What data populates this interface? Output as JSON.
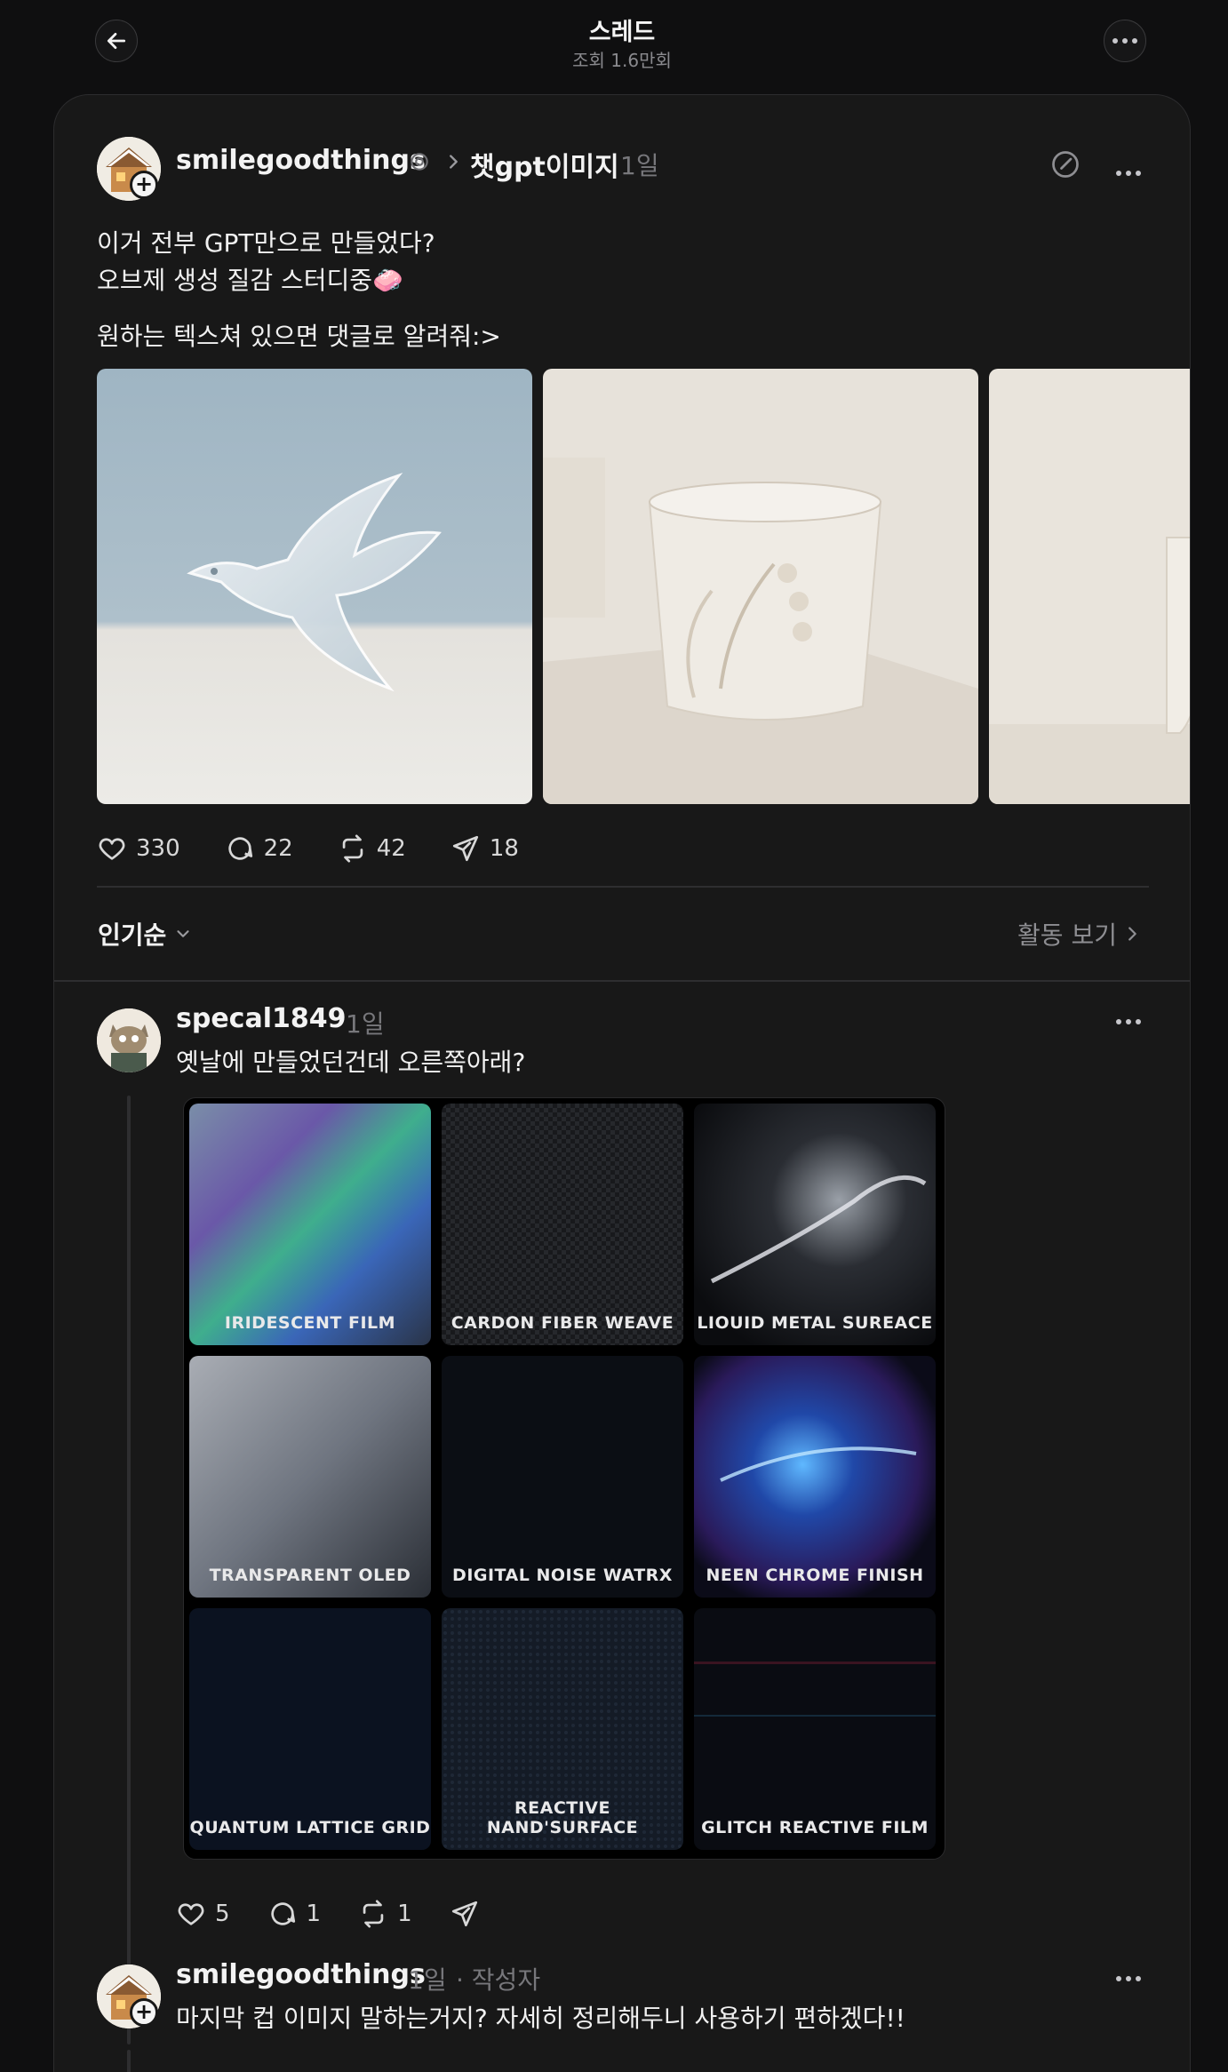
{
  "header": {
    "title": "스레드",
    "subtitle": "조회 1.6만회"
  },
  "post": {
    "username": "smilegoodthings",
    "topic": "챗gpt이미지",
    "time": "1일",
    "lines": [
      "이거 전부 GPT만으로 만들었다?",
      "오브제 생성 질감 스터디중🧼",
      "원하는 텍스쳐 있으면 댓글로 알려줘:>"
    ],
    "images": [
      "glass-bird-image",
      "lily-cup-image",
      "vase-image"
    ],
    "likes": "330",
    "comments": "22",
    "reposts": "42",
    "shares": "18"
  },
  "sort": {
    "label": "인기순",
    "activity": "활동 보기"
  },
  "reply1": {
    "username": "specal1849",
    "time": "1일",
    "text": "옛날에 만들었던건데 오른쪽아래?",
    "tiles": [
      "IRIDESCENT FILM",
      "CARDON FIBER WEAVE",
      "LIOUID METAL SUREACE",
      "TRANSPARENT OLED",
      "DIGITAL NOISE WATRX",
      "NEEN CHROME FINISH",
      "QUANTUM LATTICE GRID",
      "REACTIVE NAND'SURFACE",
      "GLITCH REACTIVE FILM"
    ],
    "likes": "5",
    "comments": "1",
    "reposts": "1"
  },
  "reply2": {
    "username": "smilegoodthings",
    "time": "1일",
    "author_tag": "· 작성자",
    "text": "마지막 컵 이미지 말하는거지? 자세히 정리해두니 사용하기 편하겠다!!"
  },
  "colors": {
    "background": "#0f0f10",
    "card": "#181818",
    "text": "#f3f3f3",
    "muted": "#77777b"
  }
}
